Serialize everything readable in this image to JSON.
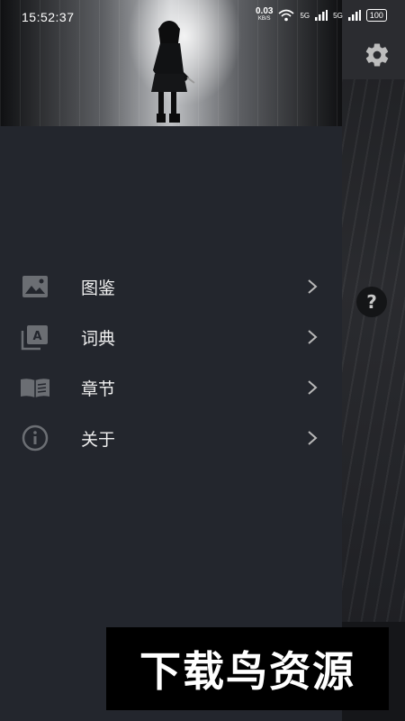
{
  "status_bar": {
    "time": "15:52:37",
    "net_speed": "0.03",
    "net_speed_unit": "KB/S",
    "signal1": "5G",
    "signal2": "5G",
    "battery": "100"
  },
  "menu": {
    "items": [
      {
        "label": "图鉴",
        "icon": "image-icon"
      },
      {
        "label": "词典",
        "icon": "dictionary-icon"
      },
      {
        "label": "章节",
        "icon": "book-icon"
      },
      {
        "label": "关于",
        "icon": "info-icon"
      }
    ]
  },
  "help_label": "?",
  "watermark": "下载鸟资源"
}
